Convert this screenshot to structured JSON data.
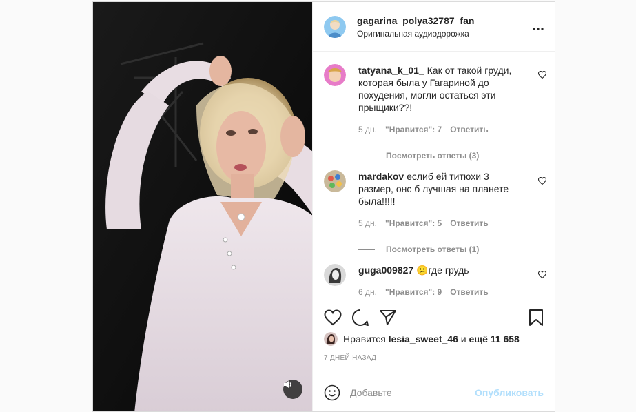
{
  "header": {
    "username": "gagarina_polya32787_fan",
    "subtitle": "Оригинальная аудиодорожка",
    "more_icon": "more-horizontal-icon"
  },
  "comments": [
    {
      "username": "tatyana_k_01_",
      "text": "Как от такой груди, которая была у Гагариной до похудения, могли остаться эти прыщики??!",
      "time": "5 дн.",
      "likes": "\"Нравится\": 7",
      "reply": "Ответить",
      "view_replies": "Посмотреть ответы (3)"
    },
    {
      "username": "mardakov",
      "text": "еслиб ей титюхи 3 размер, онс б лучшая на планете была!!!!!",
      "time": "5 дн.",
      "likes": "\"Нравится\": 5",
      "reply": "Ответить",
      "view_replies": "Посмотреть ответы (1)"
    },
    {
      "username": "guga009827",
      "emoji": "😕",
      "text": "где грудь",
      "time": "6 дн.",
      "likes": "\"Нравится\": 9",
      "reply": "Ответить"
    }
  ],
  "likes": {
    "prefix": "Нравится",
    "user": "lesia_sweet_46",
    "connector": "и",
    "others": "ещё 11 658"
  },
  "date": "7 ДНЕЙ НАЗАД",
  "add_comment": {
    "placeholder": "Добавьте",
    "publish": "Опубликовать"
  },
  "colors": {
    "border": "#dbdbdb",
    "muted": "#8e8e8e",
    "publish_disabled": "#b2dffc",
    "text": "#262626"
  }
}
